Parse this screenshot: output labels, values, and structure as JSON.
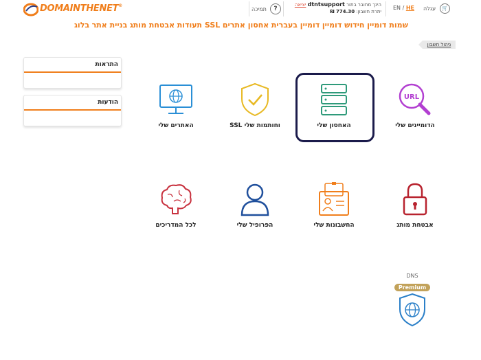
{
  "brand": {
    "logo_text": "DOMAINTHENET",
    "logo_reg": "®",
    "accent": "#f07e1b"
  },
  "topbar": {
    "cart_label": "עגלה",
    "lang_en": "EN",
    "lang_sep": " / ",
    "lang_he": "HE",
    "logged_in_prefix": "הינך מחובר בתור",
    "username": "dtntsupport",
    "logout_label": "יציאה",
    "balance_label": "יתרת חשבון:",
    "balance_value": "774.30 ₪",
    "support_label": "תמיכה"
  },
  "nav": [
    "שמות דומיין",
    "חידוש דומיין",
    "דומיין בעברית",
    "אחסון אתרים",
    "תעודות SSL",
    "אבטחת מותג",
    "בניית אתר",
    "בלוג"
  ],
  "breadcrumb": "ניהול חשבון",
  "sidebar": {
    "alerts_title": "התראות",
    "messages_title": "הודעות"
  },
  "tiles": {
    "domains": "הדומיינים שלי",
    "hosting": "האחסון שלי",
    "ssl": "SSL וחותמות שלי",
    "sites": "האתרים שלי",
    "security": "אבטחת מותג",
    "accounts": "החשבונות שלי",
    "profile": "הפרופיל שלי",
    "guides": "לכל המדריכים"
  },
  "dns_premium": {
    "dns": "DNS",
    "premium": "Premium"
  },
  "icons": {
    "domains": "url-magnifier-icon",
    "hosting": "server-icon",
    "ssl": "shield-check-icon",
    "sites": "monitor-globe-icon",
    "security": "padlock-icon",
    "accounts": "id-cards-icon",
    "profile": "user-icon",
    "guides": "brain-icon",
    "dns": "shield-globe-icon"
  }
}
